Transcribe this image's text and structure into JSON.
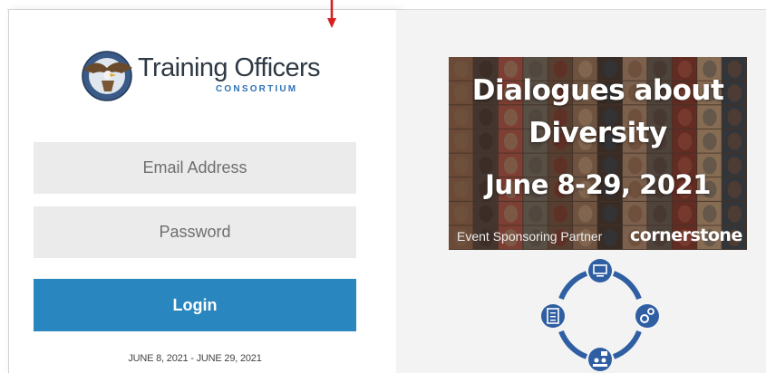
{
  "login": {
    "logo": {
      "title": "Training Officers",
      "subtitle": "CONSORTIUM"
    },
    "email_placeholder": "Email Address",
    "password_placeholder": "Password",
    "login_label": "Login",
    "dates": "JUNE 8, 2021  -  JUNE 29, 2021"
  },
  "promo": {
    "line1": "Dialogues about",
    "line2": "Diversity",
    "line3": "June 8-29, 2021",
    "sponsor": "Event Sponsoring Partner",
    "brand": "cornerstone"
  },
  "icons": {
    "arrow": "down-arrow-icon",
    "cycle": [
      "computer-icon",
      "gears-icon",
      "people-chat-icon",
      "checklist-icon"
    ]
  },
  "colors": {
    "primary": "#2a86bf",
    "cycle_blue": "#2f5ea3",
    "arrow_red": "#d62020",
    "field_bg": "#ebebeb"
  }
}
